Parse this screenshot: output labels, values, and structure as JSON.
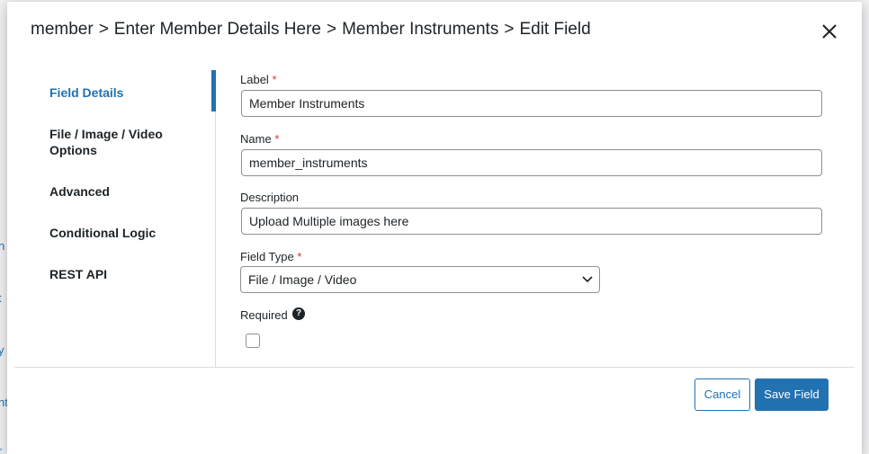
{
  "background": {
    "fragments": [
      "n",
      "t",
      "y",
      "nt",
      "r"
    ]
  },
  "header": {
    "breadcrumb": [
      "member",
      "Enter Member Details Here",
      "Member Instruments",
      "Edit Field"
    ],
    "separator": ">",
    "close_icon": "close-icon"
  },
  "sidebar": {
    "items": [
      {
        "label": "Field Details",
        "active": true
      },
      {
        "label": "File / Image / Video Options",
        "active": false
      },
      {
        "label": "Advanced",
        "active": false
      },
      {
        "label": "Conditional Logic",
        "active": false
      },
      {
        "label": "REST API",
        "active": false
      }
    ]
  },
  "form": {
    "label_field": {
      "label": "Label",
      "required_mark": "*",
      "value": "Member Instruments"
    },
    "name_field": {
      "label": "Name",
      "required_mark": "*",
      "value": "member_instruments"
    },
    "description_field": {
      "label": "Description",
      "required_mark": "",
      "value": "Upload Multiple images here"
    },
    "field_type": {
      "label": "Field Type",
      "required_mark": "*",
      "value": "File / Image / Video"
    },
    "required": {
      "label": "Required",
      "help_icon": "?",
      "checked": false
    }
  },
  "footer": {
    "cancel_label": "Cancel",
    "save_label": "Save Field"
  },
  "colors": {
    "accent": "#2271b1",
    "required": "#d63638",
    "text": "#1d2327",
    "border": "#8c8f94"
  }
}
